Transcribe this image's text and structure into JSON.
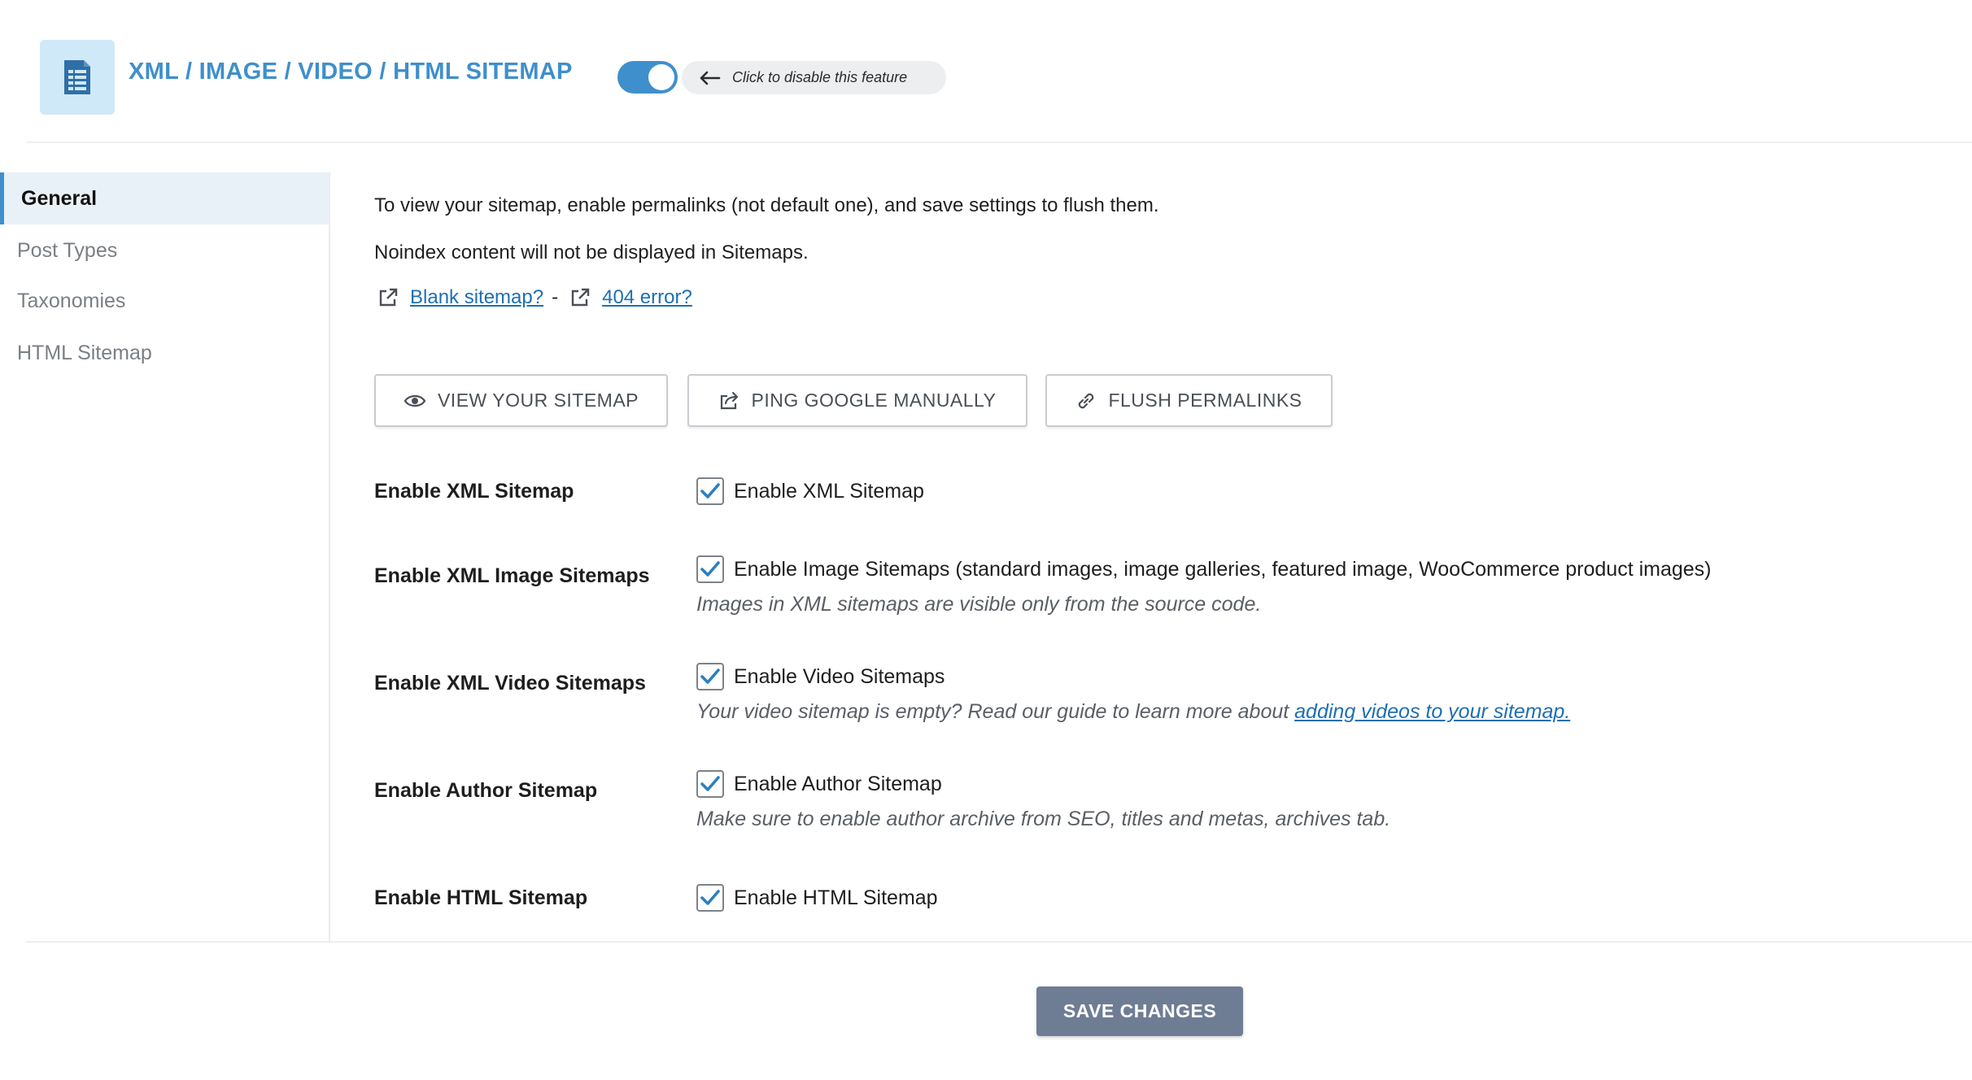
{
  "header": {
    "title": "XML / IMAGE / VIDEO / HTML SITEMAP",
    "icon": "sitemap-document-icon",
    "toggle_on": true,
    "toggle_hint": "Click to disable this feature",
    "accent": "#3f8fcc"
  },
  "sidebar": {
    "items": [
      {
        "label": "General",
        "active": true
      },
      {
        "label": "Post Types",
        "active": false
      },
      {
        "label": "Taxonomies",
        "active": false
      },
      {
        "label": "HTML Sitemap",
        "active": false
      }
    ]
  },
  "main": {
    "intro_1": "To view your sitemap, enable permalinks (not default one), and save settings to flush them.",
    "intro_2": "Noindex content will not be displayed in Sitemaps.",
    "links": {
      "blank": "Blank sitemap?",
      "separator": "-",
      "error404": "404 error?"
    },
    "buttons": {
      "view": "VIEW YOUR SITEMAP",
      "ping": "PING GOOGLE MANUALLY",
      "flush": "FLUSH PERMALINKS"
    },
    "settings": [
      {
        "label": "Enable XML Sitemap",
        "checkbox": "Enable XML Sitemap",
        "checked": true
      },
      {
        "label": "Enable XML Image Sitemaps",
        "checkbox": "Enable Image Sitemaps (standard images, image galleries, featured image, WooCommerce product images)",
        "checked": true,
        "hint": "Images in XML sitemaps are visible only from the source code."
      },
      {
        "label": "Enable XML Video Sitemaps",
        "checkbox": "Enable Video Sitemaps",
        "checked": true,
        "hint": "Your video sitemap is empty? Read our guide to learn more about ",
        "hint_link": "adding videos to your sitemap."
      },
      {
        "label": "Enable Author Sitemap",
        "checkbox": "Enable Author Sitemap",
        "checked": true,
        "hint": "Make sure to enable author archive from SEO, titles and metas, archives tab."
      },
      {
        "label": "Enable HTML Sitemap",
        "checkbox": "Enable HTML Sitemap",
        "checked": true
      }
    ]
  },
  "footer": {
    "save_label": "SAVE CHANGES"
  }
}
